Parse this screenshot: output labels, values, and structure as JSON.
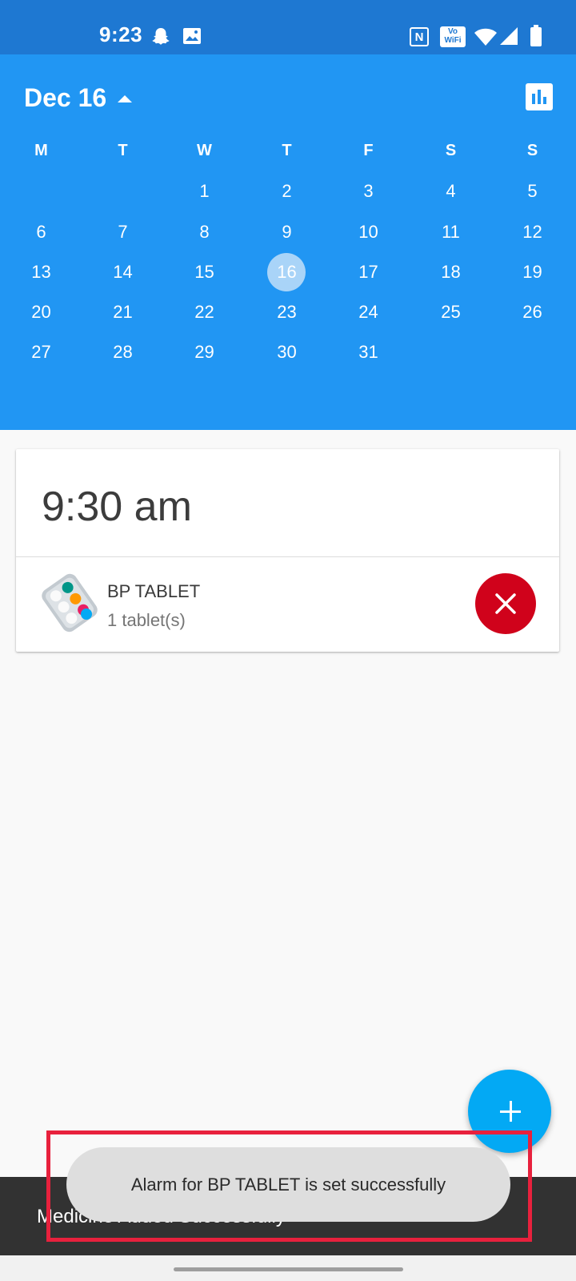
{
  "status_bar": {
    "time": "9:23",
    "icons": [
      "snapchat-ghost",
      "gallery-image",
      "nfc",
      "vowifi",
      "wifi",
      "signal",
      "battery"
    ],
    "nfc_label": "N",
    "vowifi_label_top": "Vo",
    "vowifi_label_bottom": "WiFi"
  },
  "calendar": {
    "month_label": "Dec 16",
    "stats_icon": "bar-chart",
    "weekdays": [
      "M",
      "T",
      "W",
      "T",
      "F",
      "S",
      "S"
    ],
    "weeks": [
      [
        "",
        "",
        "1",
        "2",
        "3",
        "4",
        "5"
      ],
      [
        "6",
        "7",
        "8",
        "9",
        "10",
        "11",
        "12"
      ],
      [
        "13",
        "14",
        "15",
        "16",
        "17",
        "18",
        "19"
      ],
      [
        "20",
        "21",
        "22",
        "23",
        "24",
        "25",
        "26"
      ],
      [
        "27",
        "28",
        "29",
        "30",
        "31",
        "",
        ""
      ]
    ],
    "selected_day": "16"
  },
  "dose_card": {
    "time": "9:30 am",
    "medicine": {
      "icon": "pill-blister-pack",
      "name": "BP TABLET",
      "dosage": "1 tablet(s)",
      "delete_icon": "close"
    }
  },
  "fab": {
    "icon": "plus"
  },
  "snackbar": {
    "text": "Medicine Added Successfully"
  },
  "toast": {
    "text": "Alarm for BP TABLET is set successfully"
  },
  "colors": {
    "status_bar": "#1e78d2",
    "calendar_bg": "#2196f3",
    "selected_day": "#a9d4f8",
    "delete_button": "#d0021b",
    "fab": "#03a9f4",
    "highlight": "#e8213d"
  }
}
